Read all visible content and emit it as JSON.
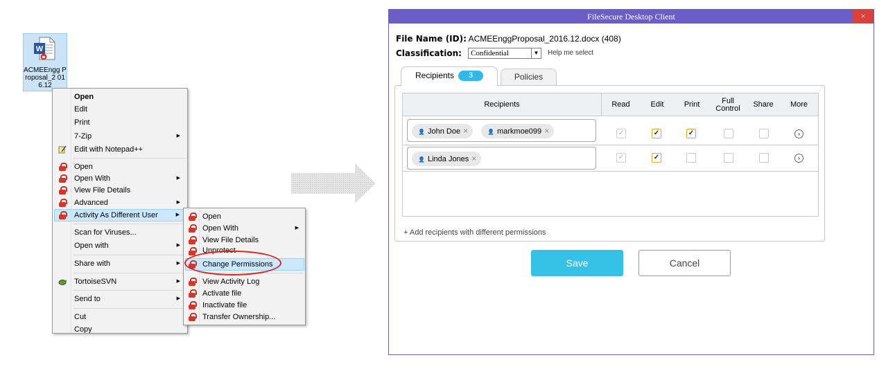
{
  "desktop": {
    "file_icon_label": "ACMEEngg Proposal_2 016.12"
  },
  "context_menu": {
    "items": [
      {
        "label": "Open"
      },
      {
        "label": "Edit"
      },
      {
        "label": "Print"
      },
      {
        "label": "7-Zip"
      },
      {
        "label": "Edit with Notepad++"
      },
      {
        "label": "Open"
      },
      {
        "label": "Open With"
      },
      {
        "label": "View File Details"
      },
      {
        "label": "Advanced"
      },
      {
        "label": "Activity As Different User"
      },
      {
        "label": "Scan for Viruses..."
      },
      {
        "label": "Open with"
      },
      {
        "label": "Share with"
      },
      {
        "label": "TortoiseSVN"
      },
      {
        "label": "Send to"
      },
      {
        "label": "Cut"
      },
      {
        "label": "Copy"
      }
    ]
  },
  "submenu": {
    "items": [
      {
        "label": "Open"
      },
      {
        "label": "Open With"
      },
      {
        "label": "View File Details"
      },
      {
        "label": "Unprotect"
      },
      {
        "label": "Change Permissions"
      },
      {
        "label": "View Activity Log"
      },
      {
        "label": "Activate file"
      },
      {
        "label": "Inactivate file"
      },
      {
        "label": "Transfer Ownership..."
      }
    ]
  },
  "dialog": {
    "title": "FileSecure Desktop Client",
    "close_label": "×",
    "file_name_label": "File Name (ID):",
    "file_name_value": "ACMEEnggProposal_2016.12.docx (408)",
    "classification_label": "Classification:",
    "classification_value": "Confidential",
    "help_link": "Help me select",
    "tabs": {
      "recipients_label": "Recipients",
      "recipients_count": "3",
      "policies_label": "Policies"
    },
    "columns": {
      "recipients": "Recipients",
      "read": "Read",
      "edit": "Edit",
      "print": "Print",
      "full_control_1": "Full",
      "full_control_2": "Control",
      "share": "Share",
      "more": "More"
    },
    "rows": [
      {
        "recipients": [
          "John Doe",
          "markmoe099"
        ],
        "read": true,
        "edit": true,
        "print": true,
        "full_control": false,
        "share": false
      },
      {
        "recipients": [
          "Linda Jones"
        ],
        "read": true,
        "edit": true,
        "print": false,
        "full_control": false,
        "share": false
      }
    ],
    "add_link": "+ Add recipients with different permissions",
    "save_label": "Save",
    "cancel_label": "Cancel"
  },
  "colors": {
    "titlebar": "#6b5fc7",
    "accent": "#35c0e6",
    "close": "#d9423a",
    "highlight_oval": "#e0201c"
  }
}
